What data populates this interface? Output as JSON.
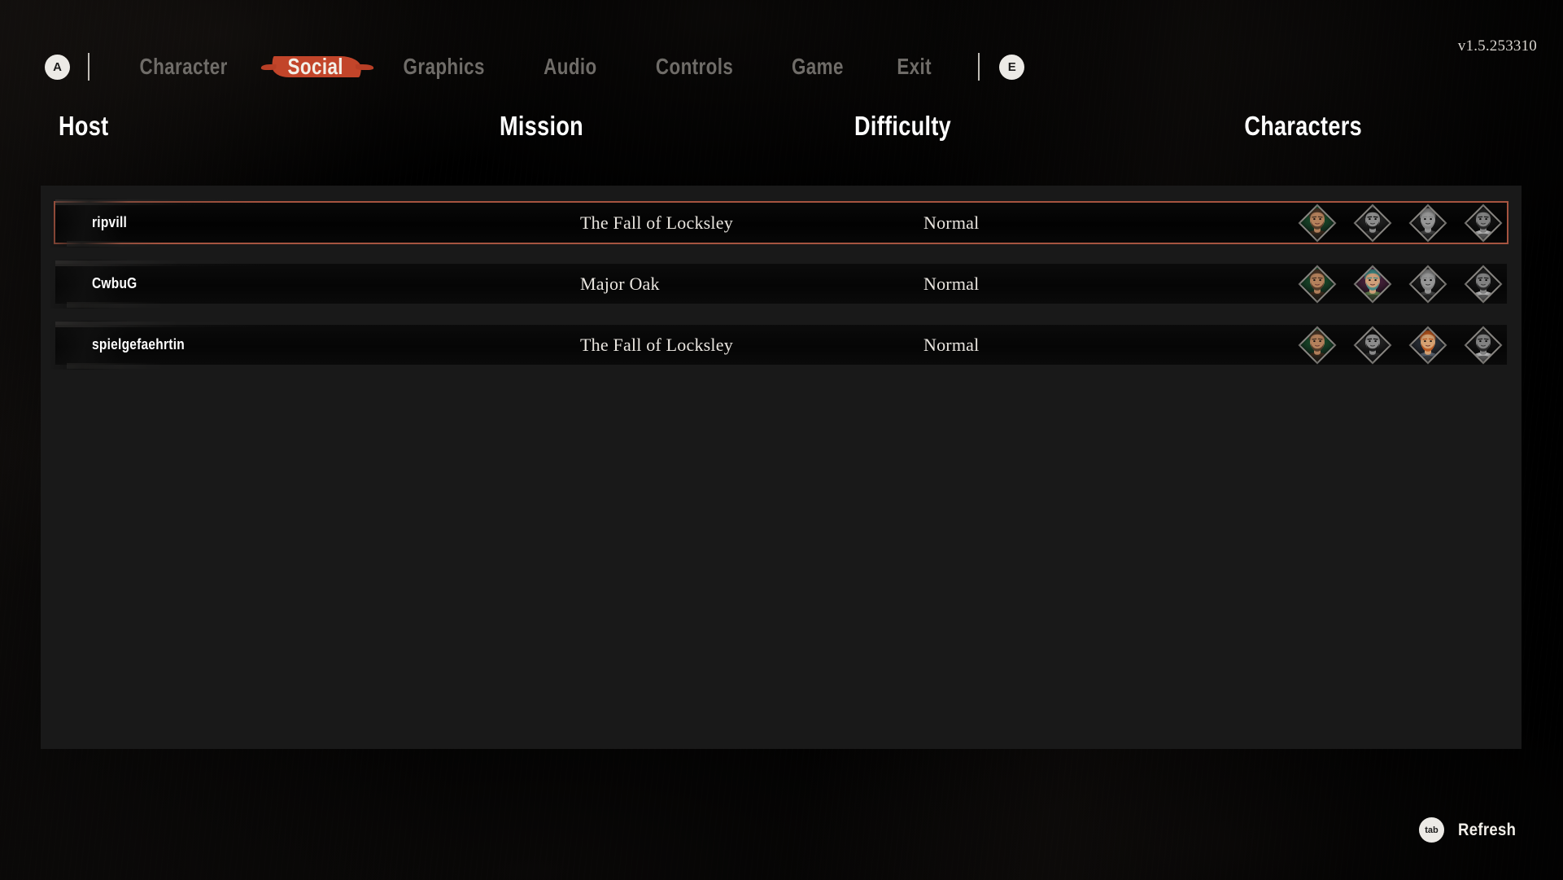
{
  "version": "v1.5.253310",
  "nav": {
    "left_key": "A",
    "right_key": "E",
    "items": [
      {
        "label": "Character",
        "active": false
      },
      {
        "label": "Social",
        "active": true
      },
      {
        "label": "Graphics",
        "active": false
      },
      {
        "label": "Audio",
        "active": false
      },
      {
        "label": "Controls",
        "active": false
      },
      {
        "label": "Game",
        "active": false
      },
      {
        "label": "Exit",
        "active": false
      }
    ],
    "accent_color": "#c2452a"
  },
  "columns": {
    "host": "Host",
    "mission": "Mission",
    "difficulty": "Difficulty",
    "characters": "Characters"
  },
  "lobbies": [
    {
      "host": "ripvill",
      "mission": "The Fall of Locksley",
      "difficulty": "Normal",
      "selected": true,
      "characters": [
        {
          "name": "ranger-green",
          "active": true,
          "bg": "#1f6b3a",
          "skin": "#b4815c",
          "hair": "#4a3526",
          "accent": "#3a2a1c"
        },
        {
          "name": "scout-female",
          "active": false,
          "bg": "#6b3a5a",
          "skin": "#c08f6a",
          "hair": "#2b1d15",
          "accent": "#4a2f24"
        },
        {
          "name": "knight-grey",
          "active": false,
          "bg": "#3a3a42",
          "skin": "#c49a78",
          "hair": "#8d8d8d",
          "accent": "#4d4d52"
        },
        {
          "name": "friar-tuck",
          "active": false,
          "bg": "#2d2d30",
          "skin": "#b5845f",
          "hair": "#3b2c20",
          "accent": "#cfc9bd"
        }
      ]
    },
    {
      "host": "CwbuG",
      "mission": "Major Oak",
      "difficulty": "Normal",
      "selected": false,
      "characters": [
        {
          "name": "ranger-green",
          "active": true,
          "bg": "#1f6b3a",
          "skin": "#b4815c",
          "hair": "#4a3526",
          "accent": "#3a2a1c"
        },
        {
          "name": "scout-female",
          "active": true,
          "bg": "#6b2f57",
          "skin": "#d0a07a",
          "hair": "#3f8a86",
          "accent": "#5d7a4a"
        },
        {
          "name": "knight-grey",
          "active": false,
          "bg": "#3a3a42",
          "skin": "#c49a78",
          "hair": "#8d8d8d",
          "accent": "#4d4d52"
        },
        {
          "name": "friar-tuck",
          "active": false,
          "bg": "#2d2d30",
          "skin": "#b5845f",
          "hair": "#3b2c20",
          "accent": "#cfc9bd"
        }
      ]
    },
    {
      "host": "spielgefaehrtin",
      "mission": "The Fall of Locksley",
      "difficulty": "Normal",
      "selected": false,
      "characters": [
        {
          "name": "ranger-green",
          "active": true,
          "bg": "#1f6b3a",
          "skin": "#b4815c",
          "hair": "#4a3526",
          "accent": "#3a2a1c"
        },
        {
          "name": "scout-female",
          "active": false,
          "bg": "#6b3a5a",
          "skin": "#c08f6a",
          "hair": "#2b1d15",
          "accent": "#4a2f24"
        },
        {
          "name": "knight-ginger",
          "active": true,
          "bg": "#3b4450",
          "skin": "#d6a273",
          "hair": "#b8561f",
          "accent": "#5a6370"
        },
        {
          "name": "friar-tuck",
          "active": false,
          "bg": "#2d2d30",
          "skin": "#b5845f",
          "hair": "#3b2c20",
          "accent": "#cfc9bd"
        }
      ]
    }
  ],
  "footer": {
    "key": "tab",
    "action": "Refresh"
  }
}
